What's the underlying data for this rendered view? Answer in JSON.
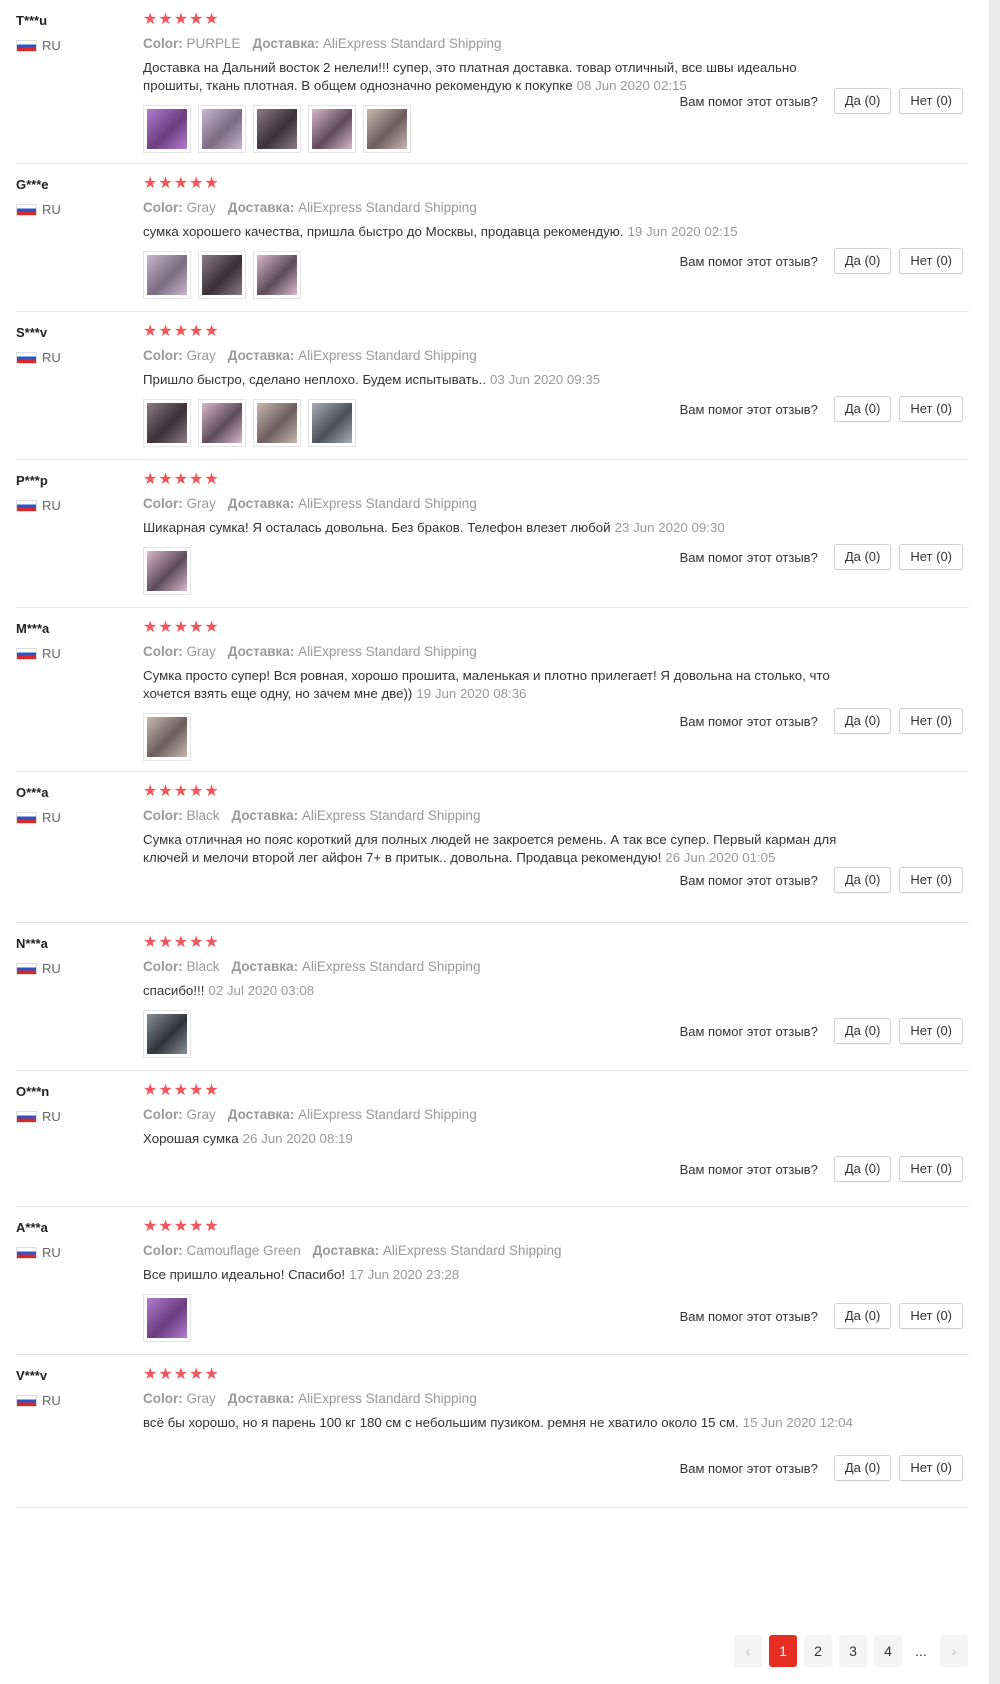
{
  "labels": {
    "color": "Color:",
    "delivery": "Доставка:",
    "helpful_question": "Вам помог этот отзыв?"
  },
  "reviews": [
    {
      "user": "T***u",
      "country": "RU",
      "stars": "★★★★★",
      "color": "PURPLE",
      "shipping": "AliExpress Standard Shipping",
      "text": "Доставка на Дальний восток 2 нелели!!! супер, это платная доставка. товар отличный, все швы идеально прошиты, ткань плотная. В общем однозначно рекомендую к покупке",
      "date": "08 Jun 2020 02:15",
      "photos": 5,
      "yes": "Да (0)",
      "no": "Нет (0)"
    },
    {
      "user": "G***e",
      "country": "RU",
      "stars": "★★★★★",
      "color": "Gray",
      "shipping": "AliExpress Standard Shipping",
      "text": "сумка хорошего качества, пришла быстро до Москвы, продавца рекомендую.",
      "date": "19 Jun 2020 02:15",
      "photos": 3,
      "yes": "Да (0)",
      "no": "Нет (0)"
    },
    {
      "user": "S***v",
      "country": "RU",
      "stars": "★★★★★",
      "color": "Gray",
      "shipping": "AliExpress Standard Shipping",
      "text": "Пришло быстро, сделано неплохо. Будем испытывать..",
      "date": "03 Jun 2020 09:35",
      "photos": 4,
      "yes": "Да (0)",
      "no": "Нет (0)"
    },
    {
      "user": "P***p",
      "country": "RU",
      "stars": "★★★★★",
      "color": "Gray",
      "shipping": "AliExpress Standard Shipping",
      "text": "Шикарная сумка! Я осталась довольна. Без браков. Телефон влезет любой",
      "date": "23 Jun 2020 09:30",
      "photos": 1,
      "yes": "Да (0)",
      "no": "Нет (0)"
    },
    {
      "user": "M***a",
      "country": "RU",
      "stars": "★★★★★",
      "color": "Gray",
      "shipping": "AliExpress Standard Shipping",
      "text": "Сумка просто супер! Вся ровная, хорошо прошита, маленькая и плотно прилегает! Я довольна на столько, что хочется взять еще одну, но зачем мне две))",
      "date": "19 Jun 2020 08:36",
      "photos": 1,
      "yes": "Да (0)",
      "no": "Нет (0)"
    },
    {
      "user": "O***a",
      "country": "RU",
      "stars": "★★★★★",
      "color": "Black",
      "shipping": "AliExpress Standard Shipping",
      "text": "Сумка отличная но пояс короткий для полных людей не закроется ремень. А так все супер. Первый карман для ключей и мелочи второй лег айфон 7+ в притык.. довольна. Продавца рекомендую!",
      "date": "26 Jun 2020 01:05",
      "photos": 0,
      "yes": "Да (0)",
      "no": "Нет (0)"
    },
    {
      "user": "N***a",
      "country": "RU",
      "stars": "★★★★★",
      "color": "Black",
      "shipping": "AliExpress Standard Shipping",
      "text": "спасибо!!!",
      "date": "02 Jul 2020 03:08",
      "photos": 1,
      "yes": "Да (0)",
      "no": "Нет (0)"
    },
    {
      "user": "O***n",
      "country": "RU",
      "stars": "★★★★★",
      "color": "Gray",
      "shipping": "AliExpress Standard Shipping",
      "text": "Хорошая сумка",
      "date": "26 Jun 2020 08:19",
      "photos": 0,
      "yes": "Да (0)",
      "no": "Нет (0)"
    },
    {
      "user": "A***a",
      "country": "RU",
      "stars": "★★★★★",
      "color": "Camouflage Green",
      "shipping": "AliExpress Standard Shipping",
      "text": "Все пришло идеально! Спасибо!",
      "date": "17 Jun 2020 23:28",
      "photos": 1,
      "yes": "Да (0)",
      "no": "Нет (0)"
    },
    {
      "user": "V***v",
      "country": "RU",
      "stars": "★★★★★",
      "color": "Gray",
      "shipping": "AliExpress Standard Shipping",
      "text": "всё бы хорошо, но я парень 100 кг 180 см с небольшим пузиком. ремня не хватило около 15 см.",
      "date": "15 Jun 2020 12:04",
      "photos": 0,
      "yes": "Да (0)",
      "no": "Нет (0)"
    }
  ],
  "pagination": {
    "prev": "‹",
    "pages": [
      "1",
      "2",
      "3",
      "4"
    ],
    "active": "1",
    "ellipsis": "...",
    "next": "›"
  }
}
